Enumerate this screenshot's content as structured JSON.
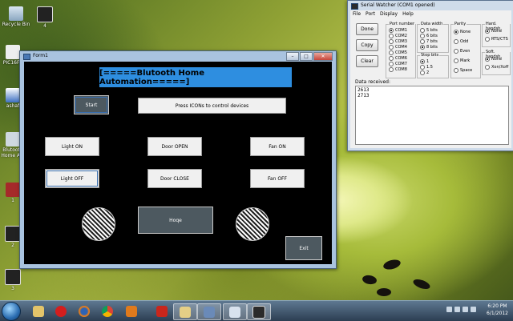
{
  "desktop": {
    "icons": [
      {
        "label": "Recycle Bin"
      },
      {
        "label": "4"
      },
      {
        "label": "PIC16F8"
      },
      {
        "label": "ashaf"
      },
      {
        "label": "Blutooth Home A..."
      },
      {
        "label": "1"
      },
      {
        "label": "2"
      },
      {
        "label": "3"
      }
    ]
  },
  "form": {
    "title": "Form1",
    "banner": "[=====Blutooth Home Automation=====]",
    "start_label": "Start",
    "status_text": "Press ICONs to control devices",
    "light_on_label": "Light ON",
    "door_open_label": "Door OPEN",
    "fan_on_label": "Fan ON",
    "light_off_label": "Light OFF",
    "door_close_label": "Door CLOSE",
    "fan_off_label": "Fan OFF",
    "house_label": "Hoqe",
    "exit_label": "Exit"
  },
  "serial": {
    "title": "Serial Watcher (COM1 opened)",
    "menu": [
      "File",
      "Port",
      "Display",
      "Help"
    ],
    "buttons": {
      "done": "Done",
      "copy": "Copy",
      "clear": "Clear"
    },
    "port_group": {
      "label": "Port number",
      "options": [
        "COM1",
        "COM2",
        "COM3",
        "COM4",
        "COM5",
        "COM6",
        "COM7",
        "COM8"
      ],
      "selected": "COM1"
    },
    "width_group": {
      "label": "Data width",
      "options": [
        "5 bits",
        "6 bits",
        "7 bits",
        "8 bits"
      ],
      "selected": "8 bits"
    },
    "stop_group": {
      "label": "Stop bits",
      "options": [
        "1",
        "1.5",
        "2"
      ],
      "selected": "1"
    },
    "parity_group": {
      "label": "Parity",
      "options": [
        "None",
        "Odd",
        "Even",
        "Mark",
        "Space"
      ],
      "selected": "None"
    },
    "hard_group": {
      "label": "Hard. handsh.",
      "options": [
        "None",
        "RTS/CTS"
      ],
      "selected": "None"
    },
    "soft_group": {
      "label": "Soft. handsh.",
      "options": [
        "None",
        "Xon/Xoff"
      ],
      "selected": "None"
    },
    "data_label": "Data received:",
    "data_lines": [
      "2613",
      "2713"
    ]
  },
  "taskbar": {
    "time": "6:20 PM",
    "date": "6/1/2012"
  }
}
